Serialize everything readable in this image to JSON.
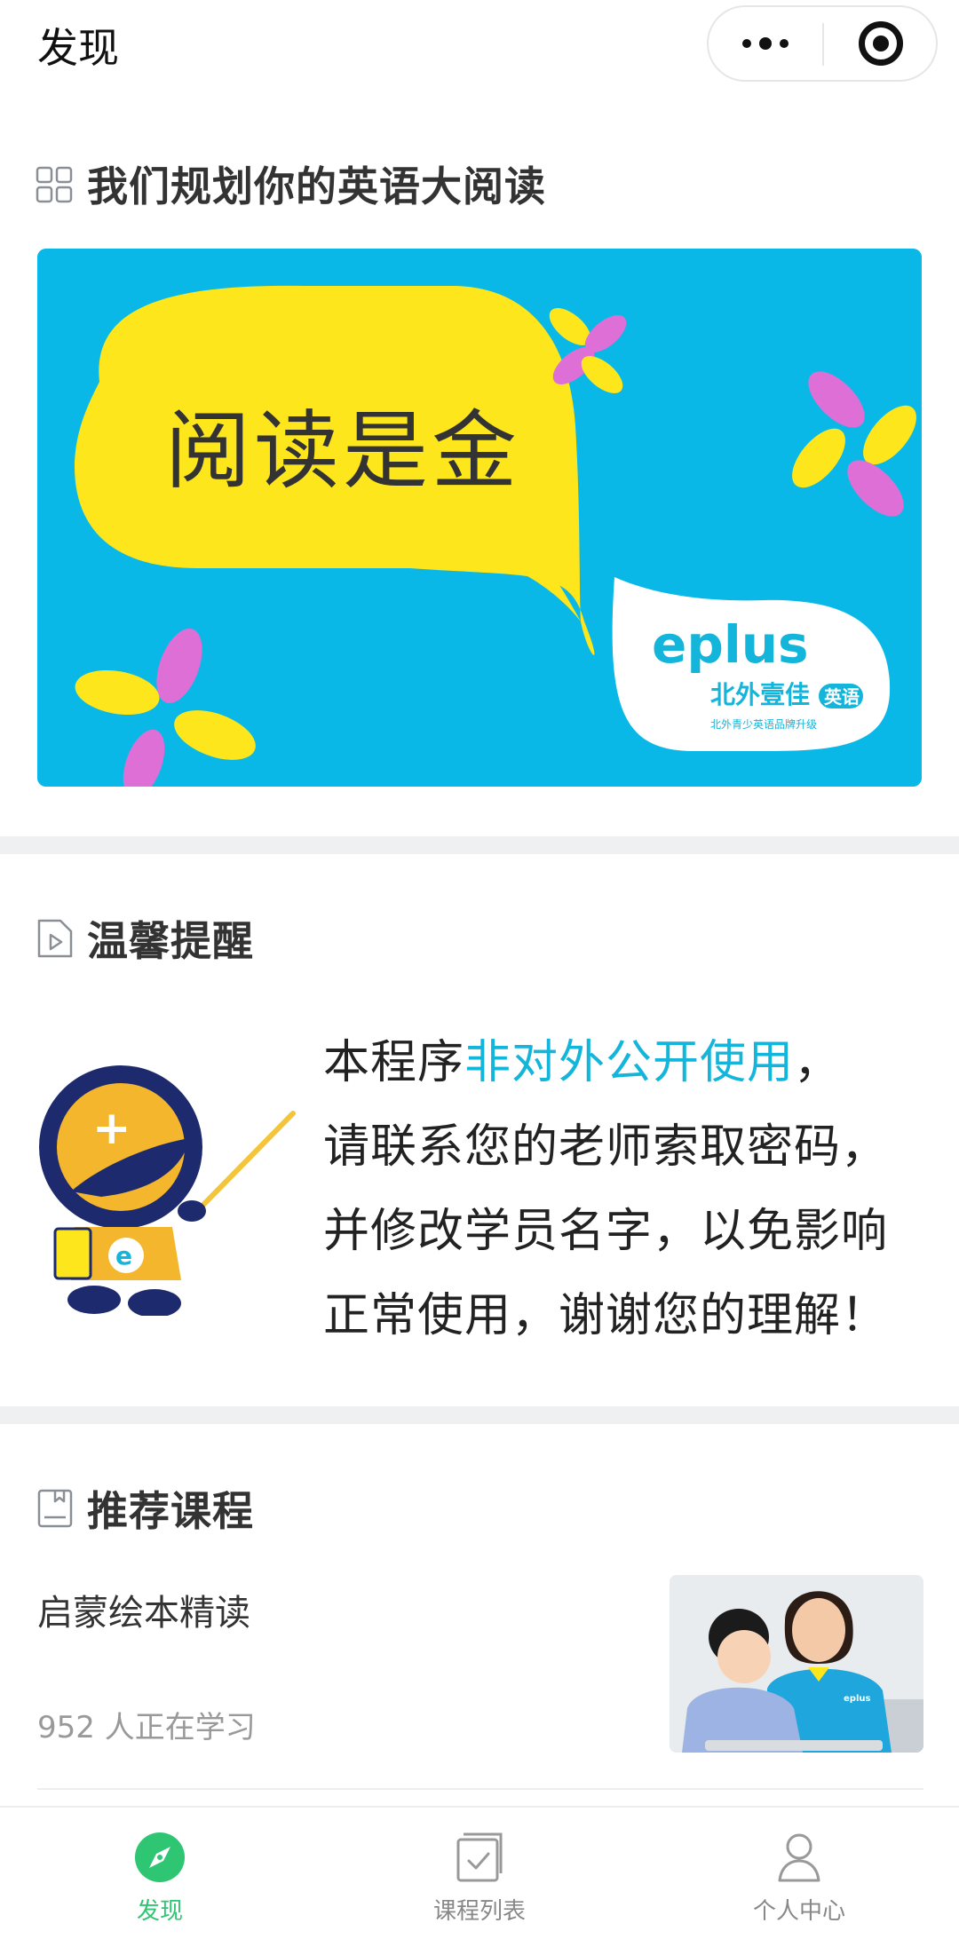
{
  "header": {
    "title": "发现",
    "more_icon": "more-dots-icon",
    "close_icon": "target-circle-icon"
  },
  "sections": {
    "reading": {
      "title": "我们规划你的英语大阅读",
      "icon": "grid-icon"
    },
    "notice": {
      "title": "温馨提醒",
      "icon": "play-document-icon"
    },
    "courses": {
      "title": "推荐课程",
      "icon": "bookmark-book-icon"
    }
  },
  "banner": {
    "headline": "阅读是金",
    "logo_text": "eplus",
    "logo_sub": "北外壹佳",
    "logo_badge": "英语",
    "logo_tagline": "北外青少英语品牌升级"
  },
  "notice": {
    "line1_before": "本程序",
    "line1_highlight": "非对外公开使用",
    "line1_after": "，",
    "line2": "请联系您的老师索取密码，",
    "line3": "并修改学员名字，以免影响",
    "line4": "正常使用，谢谢您的理解！"
  },
  "course": {
    "title": "启蒙绘本精读",
    "count_text": "952 人正在学习",
    "shirt_text": "eplus"
  },
  "tabbar": {
    "items": [
      {
        "label": "发现",
        "icon": "compass-icon",
        "active": true
      },
      {
        "label": "课程列表",
        "icon": "checklist-icon",
        "active": false
      },
      {
        "label": "个人中心",
        "icon": "person-icon",
        "active": false
      }
    ]
  },
  "colors": {
    "accent_green": "#2ec573",
    "highlight_blue": "#13b5da",
    "banner_blue": "#0ab8e8",
    "banner_yellow": "#fde61c",
    "banner_pink": "#dd6fd6"
  }
}
